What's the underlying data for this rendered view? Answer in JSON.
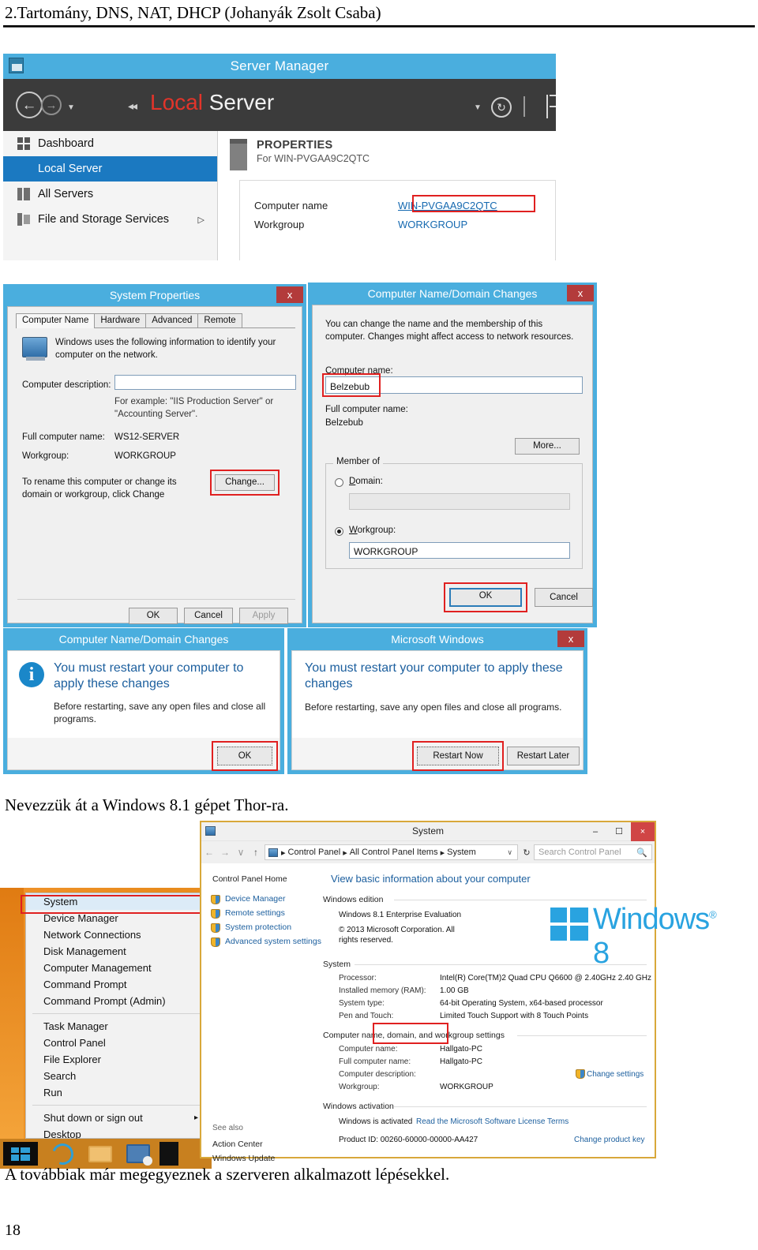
{
  "document": {
    "header": "2.Tartomány, DNS, NAT, DHCP (Johanyák Zsolt Csaba)",
    "caption1": "Nevezzük át a Windows 8.1 gépet Thor-ra.",
    "caption2": "A továbbiak már megegyeznek a szerveren alkalmazott lépésekkel.",
    "page_number": "18"
  },
  "server_manager": {
    "title": "Server Manager",
    "page_title_a": "Local",
    "page_title_b": " Server",
    "nav_items": [
      {
        "label": "Dashboard",
        "icon": "grid-icon",
        "selected": false,
        "arrow": ""
      },
      {
        "label": "Local Server",
        "icon": "server-icon",
        "selected": true,
        "arrow": ""
      },
      {
        "label": "All Servers",
        "icon": "servers-icon",
        "selected": false,
        "arrow": ""
      },
      {
        "label": "File and Storage Services",
        "icon": "files-icon",
        "selected": false,
        "arrow": "▷"
      }
    ],
    "properties": {
      "heading": "PROPERTIES",
      "subheading": "For WIN-PVGAA9C2QTC",
      "rows": [
        {
          "label": "Computer name",
          "value": "WIN-PVGAA9C2QTC"
        },
        {
          "label": "Workgroup",
          "value": "WORKGROUP"
        }
      ]
    }
  },
  "system_properties": {
    "title": "System Properties",
    "close": "x",
    "tabs": [
      "Computer Name",
      "Hardware",
      "Advanced",
      "Remote"
    ],
    "active_tab": "Computer Name",
    "intro": "Windows uses the following information to identify your computer on the network.",
    "description_label": "Computer description:",
    "description_value": "",
    "example_text": "For example: \"IIS Production Server\" or \"Accounting Server\".",
    "full_name_label": "Full computer name:",
    "full_name_value": "WS12-SERVER",
    "workgroup_label": "Workgroup:",
    "workgroup_value": "WORKGROUP",
    "rename_text": "To rename this computer or change its domain or workgroup, click Change",
    "change_button": "Change...",
    "ok": "OK",
    "cancel": "Cancel",
    "apply": "Apply"
  },
  "domain_changes": {
    "title": "Computer Name/Domain Changes",
    "close": "x",
    "intro": "You can change the name and the membership of this computer. Changes might affect access to network resources.",
    "computer_name_label": "Computer name:",
    "computer_name_value": "Belzebub",
    "full_name_label": "Full computer name:",
    "full_name_value": "Belzebub",
    "more_button": "More...",
    "member_of_label": "Member of",
    "domain_label": "Domain:",
    "domain_value": "",
    "domain_selected": false,
    "workgroup_label": "Workgroup:",
    "workgroup_value": "WORKGROUP",
    "workgroup_selected": true,
    "ok": "OK",
    "cancel": "Cancel"
  },
  "restart_left": {
    "title": "Computer Name/Domain Changes",
    "heading": "You must restart your computer to apply these changes",
    "body": "Before restarting, save any open files and close all programs.",
    "ok": "OK",
    "icon": "info-icon"
  },
  "restart_right": {
    "title": "Microsoft Windows",
    "close": "x",
    "heading": "You must restart your computer to apply these changes",
    "body": "Before restarting, save any open files and close all programs.",
    "restart_now": "Restart Now",
    "restart_later": "Restart Later"
  },
  "winx_menu": {
    "items": [
      {
        "label": "System",
        "selected": true,
        "arrow": ""
      },
      {
        "label": "Device Manager",
        "selected": false,
        "arrow": ""
      },
      {
        "label": "Network Connections",
        "selected": false,
        "arrow": ""
      },
      {
        "label": "Disk Management",
        "selected": false,
        "arrow": ""
      },
      {
        "label": "Computer Management",
        "selected": false,
        "arrow": ""
      },
      {
        "label": "Command Prompt",
        "selected": false,
        "arrow": ""
      },
      {
        "label": "Command Prompt (Admin)",
        "selected": false,
        "arrow": ""
      }
    ],
    "items2": [
      {
        "label": "Task Manager",
        "arrow": ""
      },
      {
        "label": "Control Panel",
        "arrow": ""
      },
      {
        "label": "File Explorer",
        "arrow": ""
      },
      {
        "label": "Search",
        "arrow": ""
      },
      {
        "label": "Run",
        "arrow": ""
      }
    ],
    "items3": [
      {
        "label": "Shut down or sign out",
        "arrow": "▸"
      },
      {
        "label": "Desktop",
        "arrow": ""
      }
    ]
  },
  "system_window": {
    "title": "System",
    "minimize": "–",
    "maximize": "☐",
    "close": "×",
    "address": {
      "back": "←",
      "forward": "→",
      "up": "↑",
      "breadcrumb": [
        "Control Panel",
        "All Control Panel Items",
        "System"
      ],
      "separator": "▸",
      "caret": "∨",
      "refresh": "↻",
      "search_placeholder": "Search Control Panel",
      "search_icon": "magnifier-icon"
    },
    "left_panel": {
      "home": "Control Panel Home",
      "links": [
        "Device Manager",
        "Remote settings",
        "System protection",
        "Advanced system settings"
      ],
      "see_also_label": "See also",
      "see_also_links": [
        "Action Center",
        "Windows Update"
      ]
    },
    "main": {
      "title": "View basic information about your computer",
      "edition_section": "Windows edition",
      "edition_name": "Windows 8.1 Enterprise Evaluation",
      "edition_copyright": "© 2013 Microsoft Corporation. All rights reserved.",
      "brand_text": "Windows",
      "brand_version": "8",
      "brand_tm": "®",
      "system_section": "System",
      "system_rows": [
        {
          "label": "Processor:",
          "value": "Intel(R) Core(TM)2 Quad CPU   Q6600  @ 2.40GHz  2.40 GHz"
        },
        {
          "label": "Installed memory (RAM):",
          "value": "1.00 GB"
        },
        {
          "label": "System type:",
          "value": "64-bit Operating System, x64-based processor"
        },
        {
          "label": "Pen and Touch:",
          "value": "Limited Touch Support with 8 Touch Points"
        }
      ],
      "name_section": "Computer name, domain, and workgroup settings",
      "name_rows": [
        {
          "label": "Computer name:",
          "value": "Hallgato-PC"
        },
        {
          "label": "Full computer name:",
          "value": "Hallgato-PC"
        },
        {
          "label": "Computer description:",
          "value": ""
        },
        {
          "label": "Workgroup:",
          "value": "WORKGROUP"
        }
      ],
      "change_settings": "Change settings",
      "activation_section": "Windows activation",
      "activation_status": "Windows is activated",
      "license_link": "Read the Microsoft Software License Terms",
      "product_id": "Product ID: 00260-60000-00000-AA427",
      "change_key": "Change product key"
    }
  },
  "taskbar": {
    "start": "start-button",
    "icons": [
      "internet-explorer-icon",
      "file-explorer-icon",
      "network-icon"
    ]
  }
}
